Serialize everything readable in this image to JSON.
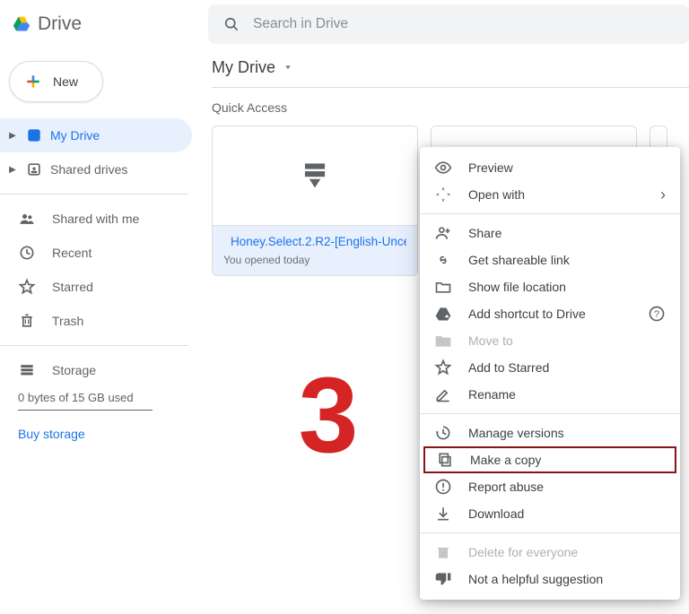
{
  "app": {
    "name": "Drive"
  },
  "search": {
    "placeholder": "Search in Drive"
  },
  "newButton": "New",
  "nav": {
    "myDrive": "My Drive",
    "sharedDrives": "Shared drives",
    "sharedWithMe": "Shared with me",
    "recent": "Recent",
    "starred": "Starred",
    "trash": "Trash",
    "storage": "Storage",
    "storageUsed": "0 bytes of 15 GB used",
    "buyStorage": "Buy storage"
  },
  "main": {
    "breadcrumb": "My Drive",
    "quickAccess": "Quick Access",
    "card": {
      "name": "Honey.Select.2.R2-[English-Unce...",
      "sub": "You opened today"
    },
    "annotationNumber": "3"
  },
  "ctx": {
    "preview": "Preview",
    "openWith": "Open with",
    "share": "Share",
    "getLink": "Get shareable link",
    "showLocation": "Show file location",
    "addShortcut": "Add shortcut to Drive",
    "moveTo": "Move to",
    "addStarred": "Add to Starred",
    "rename": "Rename",
    "manageVersions": "Manage versions",
    "makeCopy": "Make a copy",
    "reportAbuse": "Report abuse",
    "download": "Download",
    "deleteEveryone": "Delete for everyone",
    "notHelpful": "Not a helpful suggestion"
  }
}
